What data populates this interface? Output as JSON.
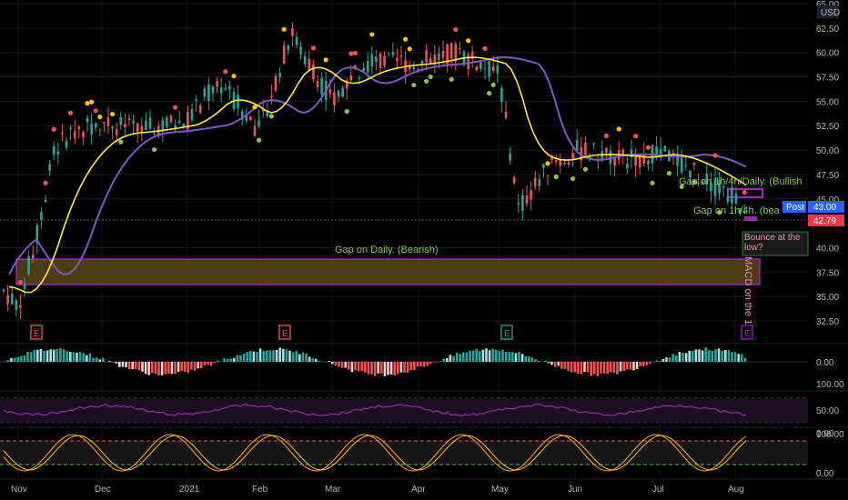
{
  "price_axis": {
    "currency": "USD",
    "ticks": [
      "65.00",
      "62.50",
      "60.00",
      "57.50",
      "55.00",
      "52.50",
      "50.00",
      "47.50",
      "45.00",
      "40.00",
      "37.50",
      "35.00",
      "32.50"
    ],
    "tick_values": [
      65,
      62.5,
      60,
      57.5,
      55,
      52.5,
      50,
      47.5,
      45,
      40,
      37.5,
      35,
      32.5
    ]
  },
  "macd_axis": {
    "ticks": [
      "0.00"
    ]
  },
  "rsi_axis": {
    "ticks": [
      "100.00",
      "50.00",
      "0.00"
    ]
  },
  "stoch_axis": {
    "ticks": [
      "100.00",
      "0.00"
    ]
  },
  "time_axis": {
    "labels": [
      "Nov",
      "Dec",
      "2021",
      "Feb",
      "Mar",
      "Apr",
      "May",
      "Jun",
      "Jul",
      "Aug"
    ]
  },
  "price_tags": {
    "post": {
      "label": "Post",
      "value": "43.00",
      "color": "#2962ff"
    },
    "last": {
      "value": "42.79",
      "color": "#f23645"
    }
  },
  "annotations": {
    "gap_daily": "Gap on Daily. (Bearish)",
    "gap_1h4h_daily": "Gap on 1h/4h/Daily. (Bullish",
    "gap_1h4h": "Gap on 1h/4h. (bea",
    "bounce": "Bounce at the low?",
    "macd_vertical": "MACD on the 1"
  },
  "earnings_markers": [
    "E",
    "E",
    "E",
    "E"
  ],
  "colors": {
    "up": "#26a69a",
    "down": "#ef5350",
    "ema_fast": "#ffeb3b",
    "ema_slow": "#7e57c2",
    "gap_box_fill": "#4a3b12",
    "gap_box_border": "#9c27b0",
    "rsi_line": "#9c27b0",
    "stoch_k": "#ff9800",
    "stoch_d": "#ffc107"
  },
  "chart_data": {
    "type": "line",
    "title": "",
    "ylabel": "USD",
    "ylim": [
      31,
      66
    ],
    "x": [
      "Nov",
      "Dec",
      "2021",
      "Feb",
      "Mar",
      "Apr",
      "May",
      "Jun",
      "Jul",
      "Aug"
    ],
    "series": [
      {
        "values": [
          34,
          50,
          53,
          50,
          60,
          58,
          49,
          48,
          49,
          44
        ]
      },
      {
        "values": [
          35,
          45,
          50,
          52,
          55,
          57,
          53,
          51,
          49,
          46
        ]
      },
      {
        "values": [
          35,
          41,
          47,
          50,
          53,
          56,
          56,
          52,
          50,
          47
        ]
      }
    ]
  }
}
